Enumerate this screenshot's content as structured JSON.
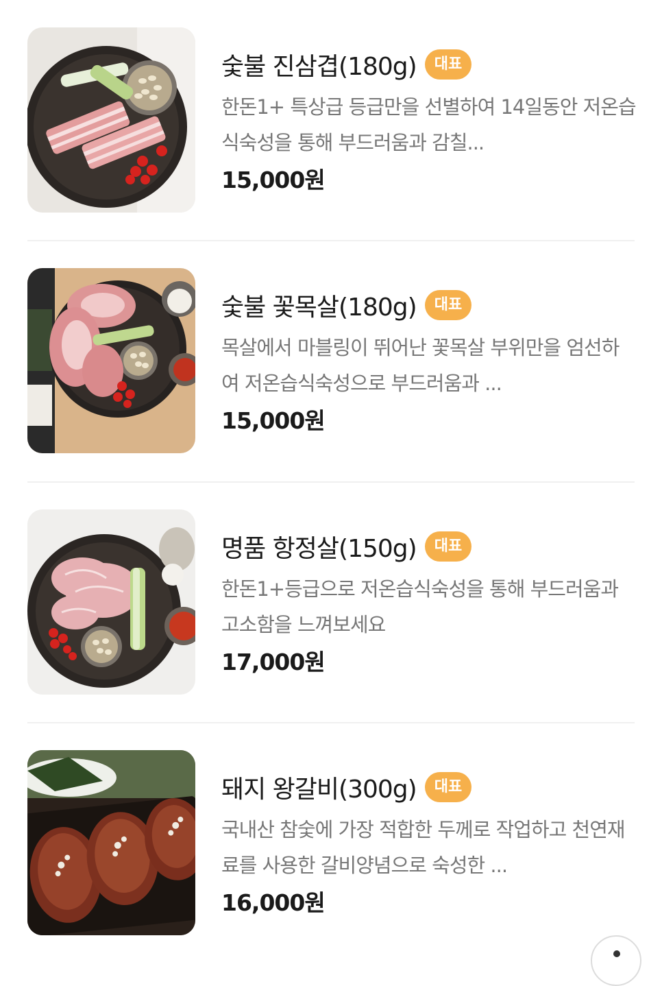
{
  "menu_items": [
    {
      "name": "숯불 진삼겹(180g)",
      "badge": "대표",
      "description": "한돈1+ 특상급 등급만을 선별하여 14일동안 저온습식숙성을 통해 부드러움과 감칠...",
      "price": "15,000원",
      "image": "pork-belly-plate-image"
    },
    {
      "name": "숯불 꽃목살(180g)",
      "badge": "대표",
      "description": "목살에서 마블링이 뛰어난 꽃목살 부위만을 엄선하여 저온습식숙성으로 부드러움과 ...",
      "price": "15,000원",
      "image": "pork-neck-plate-image"
    },
    {
      "name": "명품 항정살(150g)",
      "badge": "대표",
      "description": "한돈1+등급으로 저온습식숙성을 통해 부드러움과 고소함을 느껴보세요",
      "price": "17,000원",
      "image": "pork-jowl-plate-image"
    },
    {
      "name": "돼지 왕갈비(300g)",
      "badge": "대표",
      "description": "국내산 참숯에 가장 적합한 두께로 작업하고 천연재료를 사용한 갈비양념으로 숙성한 ...",
      "price": "16,000원",
      "image": "marinated-pork-ribs-image"
    }
  ],
  "colors": {
    "badge": "#f6b04b",
    "title": "#1a1a1a",
    "description": "#777777",
    "divider": "#f0f0f0"
  }
}
